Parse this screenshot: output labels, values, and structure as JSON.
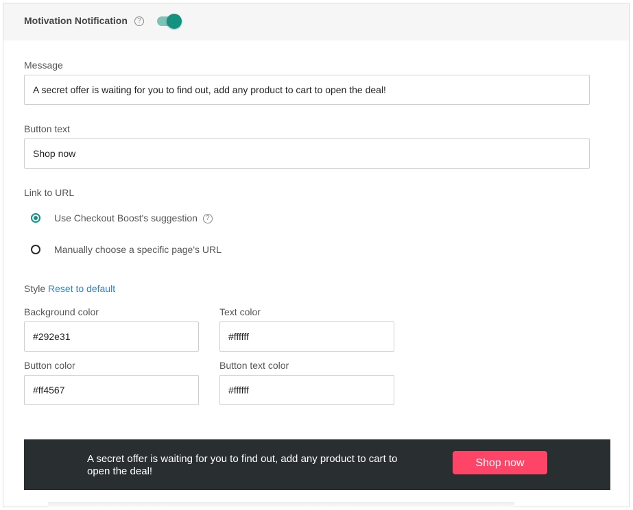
{
  "header": {
    "title": "Motivation Notification",
    "help_icon": "question-circle-icon",
    "toggle_on": true,
    "toggle_color": "#14917f"
  },
  "message": {
    "label": "Message",
    "value": "A secret offer is waiting for you to find out, add any product to cart to open the deal!"
  },
  "button_text": {
    "label": "Button text",
    "value": "Shop now"
  },
  "link": {
    "label": "Link to URL",
    "options": [
      {
        "label": "Use Checkout Boost's suggestion",
        "checked": true
      },
      {
        "label": "Manually choose a specific page's URL",
        "checked": false
      }
    ]
  },
  "style": {
    "label": "Style",
    "reset_label": "Reset to default",
    "background_color": {
      "label": "Background color",
      "value": "#292e31"
    },
    "text_color": {
      "label": "Text color",
      "value": "#ffffff"
    },
    "button_color": {
      "label": "Button color",
      "value": "#ff4567"
    },
    "button_text_color": {
      "label": "Button text color",
      "value": "#ffffff"
    }
  },
  "preview": {
    "text": "A secret offer is waiting for you to find out, add any product to cart to open the deal!",
    "button_label": "Shop now",
    "background": "#292e31",
    "button_background": "#ff4567"
  }
}
